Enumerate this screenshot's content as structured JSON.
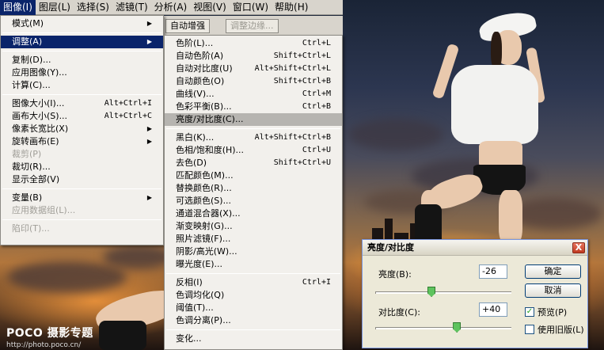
{
  "menubar": {
    "items": [
      {
        "label": "图像(I)",
        "active": true
      },
      {
        "label": "图层(L)"
      },
      {
        "label": "选择(S)"
      },
      {
        "label": "滤镜(T)"
      },
      {
        "label": "分析(A)"
      },
      {
        "label": "视图(V)"
      },
      {
        "label": "窗口(W)"
      },
      {
        "label": "帮助(H)"
      }
    ]
  },
  "options_bar": {
    "tab_auto": "自动增强",
    "tab_refine": "调整边缘..."
  },
  "image_menu": {
    "items": [
      {
        "label": "模式(M)",
        "submenu": true
      },
      {
        "separator": true
      },
      {
        "label": "调整(A)",
        "submenu": true,
        "active": true
      },
      {
        "separator": true
      },
      {
        "label": "复制(D)..."
      },
      {
        "label": "应用图像(Y)..."
      },
      {
        "label": "计算(C)..."
      },
      {
        "separator": true
      },
      {
        "label": "图像大小(I)...",
        "shortcut": "Alt+Ctrl+I"
      },
      {
        "label": "画布大小(S)...",
        "shortcut": "Alt+Ctrl+C"
      },
      {
        "label": "像素长宽比(X)",
        "submenu": true
      },
      {
        "label": "旋转画布(E)",
        "submenu": true
      },
      {
        "label": "裁剪(P)",
        "disabled": true
      },
      {
        "label": "裁切(R)..."
      },
      {
        "label": "显示全部(V)"
      },
      {
        "separator": true
      },
      {
        "label": "变量(B)",
        "submenu": true
      },
      {
        "label": "应用数据组(L)...",
        "disabled": true
      },
      {
        "separator": true
      },
      {
        "label": "陷印(T)...",
        "disabled": true
      }
    ]
  },
  "adjust_menu": {
    "items": [
      {
        "label": "色阶(L)...",
        "shortcut": "Ctrl+L"
      },
      {
        "label": "自动色阶(A)",
        "shortcut": "Shift+Ctrl+L"
      },
      {
        "label": "自动对比度(U)",
        "shortcut": "Alt+Shift+Ctrl+L"
      },
      {
        "label": "自动颜色(O)",
        "shortcut": "Shift+Ctrl+B"
      },
      {
        "label": "曲线(V)...",
        "shortcut": "Ctrl+M"
      },
      {
        "label": "色彩平衡(B)...",
        "shortcut": "Ctrl+B"
      },
      {
        "label": "亮度/对比度(C)...",
        "active": true
      },
      {
        "separator": true
      },
      {
        "label": "黑白(K)...",
        "shortcut": "Alt+Shift+Ctrl+B"
      },
      {
        "label": "色相/饱和度(H)...",
        "shortcut": "Ctrl+U"
      },
      {
        "label": "去色(D)",
        "shortcut": "Shift+Ctrl+U"
      },
      {
        "label": "匹配颜色(M)..."
      },
      {
        "label": "替换颜色(R)..."
      },
      {
        "label": "可选颜色(S)..."
      },
      {
        "label": "通道混合器(X)..."
      },
      {
        "label": "渐变映射(G)..."
      },
      {
        "label": "照片滤镜(F)..."
      },
      {
        "label": "阴影/高光(W)..."
      },
      {
        "label": "曝光度(E)..."
      },
      {
        "separator": true
      },
      {
        "label": "反相(I)",
        "shortcut": "Ctrl+I"
      },
      {
        "label": "色调均化(Q)"
      },
      {
        "label": "阈值(T)..."
      },
      {
        "label": "色调分离(P)..."
      },
      {
        "separator": true
      },
      {
        "label": "变化..."
      }
    ]
  },
  "dialog": {
    "title": "亮度/对比度",
    "brightness_label": "亮度(B):",
    "brightness_value": "-26",
    "brightness_level": -26,
    "contrast_label": "对比度(C):",
    "contrast_value": "+40",
    "contrast_level": 40,
    "ok_label": "确定",
    "cancel_label": "取消",
    "preview_label": "预览(P)",
    "preview_checked": true,
    "legacy_label": "使用旧版(L)",
    "legacy_checked": false,
    "close_glyph": "X"
  },
  "watermark": {
    "logo": "POCO 摄影专题",
    "url": "http://photo.poco.cn/"
  },
  "colors": {
    "menu_highlight": "#0a246a",
    "menu_bg": "#f2f0ec",
    "dialog_bg": "#ece9d8"
  }
}
